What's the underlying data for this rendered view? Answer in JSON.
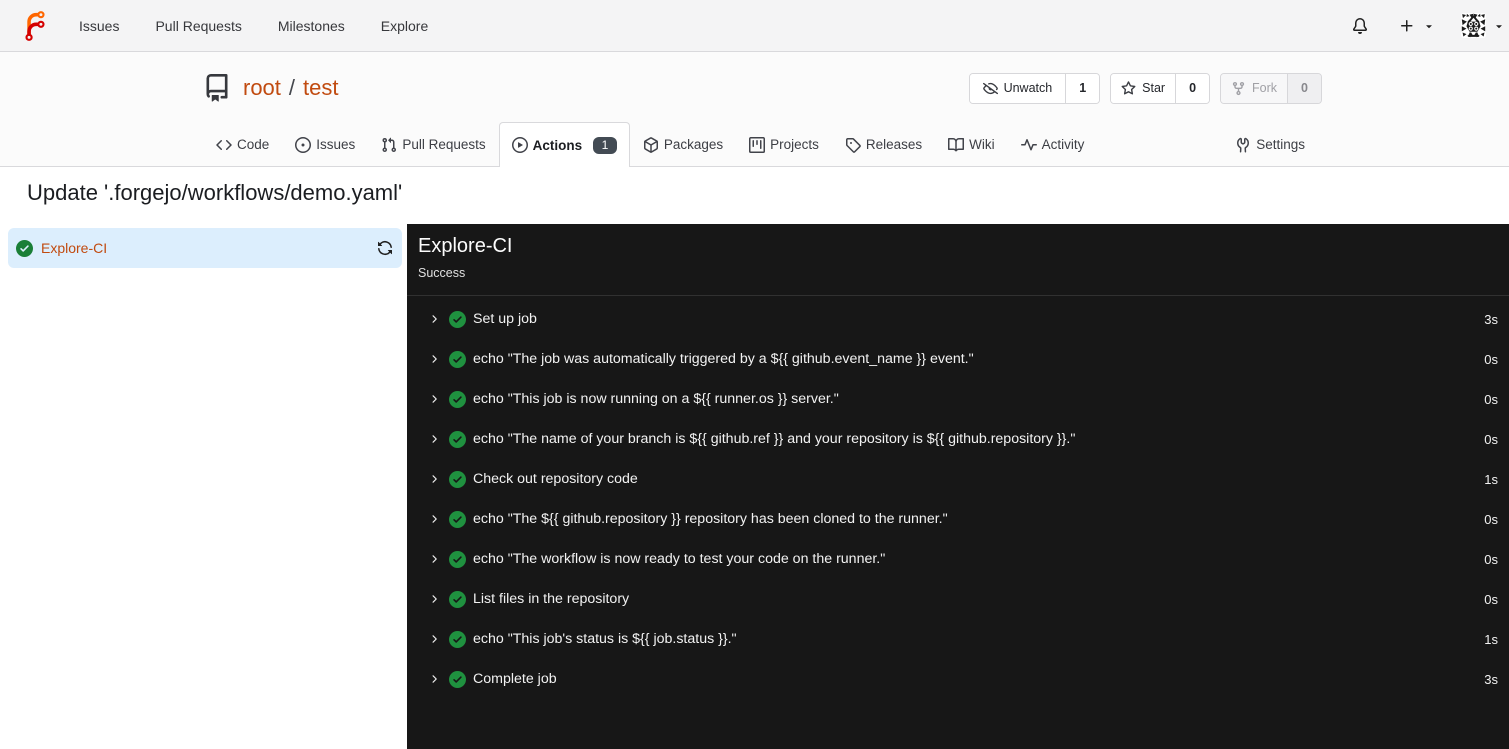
{
  "navbar": {
    "items": [
      {
        "label": "Issues"
      },
      {
        "label": "Pull Requests"
      },
      {
        "label": "Milestones"
      },
      {
        "label": "Explore"
      }
    ]
  },
  "repo": {
    "owner": "root",
    "separator": "/",
    "name": "test",
    "buttons": {
      "unwatch": {
        "label": "Unwatch",
        "count": "1"
      },
      "star": {
        "label": "Star",
        "count": "0"
      },
      "fork": {
        "label": "Fork",
        "count": "0"
      }
    }
  },
  "tabs": {
    "code": "Code",
    "issues": "Issues",
    "pulls": "Pull Requests",
    "actions": "Actions",
    "actions_badge": "1",
    "packages": "Packages",
    "projects": "Projects",
    "releases": "Releases",
    "wiki": "Wiki",
    "activity": "Activity",
    "settings": "Settings"
  },
  "run": {
    "title": "Update '.forgejo/workflows/demo.yaml'",
    "job_name": "Explore-CI",
    "panel_title": "Explore-CI",
    "panel_status": "Success",
    "steps": [
      {
        "label": "Set up job",
        "duration": "3s"
      },
      {
        "label": "echo \"The job was automatically triggered by a ${{ github.event_name }} event.\"",
        "duration": "0s"
      },
      {
        "label": "echo \"This job is now running on a ${{ runner.os }} server.\"",
        "duration": "0s"
      },
      {
        "label": "echo \"The name of your branch is ${{ github.ref }} and your repository is ${{ github.repository }}.\"",
        "duration": "0s"
      },
      {
        "label": "Check out repository code",
        "duration": "1s"
      },
      {
        "label": "echo \"The ${{ github.repository }} repository has been cloned to the runner.\"",
        "duration": "0s"
      },
      {
        "label": "echo \"The workflow is now ready to test your code on the runner.\"",
        "duration": "0s"
      },
      {
        "label": "List files in the repository",
        "duration": "0s"
      },
      {
        "label": "echo \"This job's status is ${{ job.status }}.\"",
        "duration": "1s"
      },
      {
        "label": "Complete job",
        "duration": "3s"
      }
    ]
  },
  "colors": {
    "primary": "#c14b10",
    "success_green": "#1f913f",
    "panel_bg": "#171717",
    "job_selected_bg": "#dceefd",
    "navbar_bg": "#f4f4f5",
    "header_bg": "#fbfbfb",
    "badge_bg": "#434b54",
    "logo_orange": "#ff6600",
    "logo_red": "#d40000"
  },
  "icons": [
    "forgejo-logo",
    "bell-icon",
    "plus-icon",
    "chevron-down-icon",
    "user-avatar",
    "repo-icon",
    "eye-closed-icon",
    "star-icon",
    "fork-icon",
    "code-icon",
    "issue-opened-icon",
    "git-pull-request-icon",
    "play-icon",
    "package-icon",
    "project-icon",
    "tag-icon",
    "book-icon",
    "pulse-icon",
    "tools-icon",
    "check-circle-icon",
    "rerun-icon",
    "chevron-right-icon",
    "step-success-icon"
  ]
}
